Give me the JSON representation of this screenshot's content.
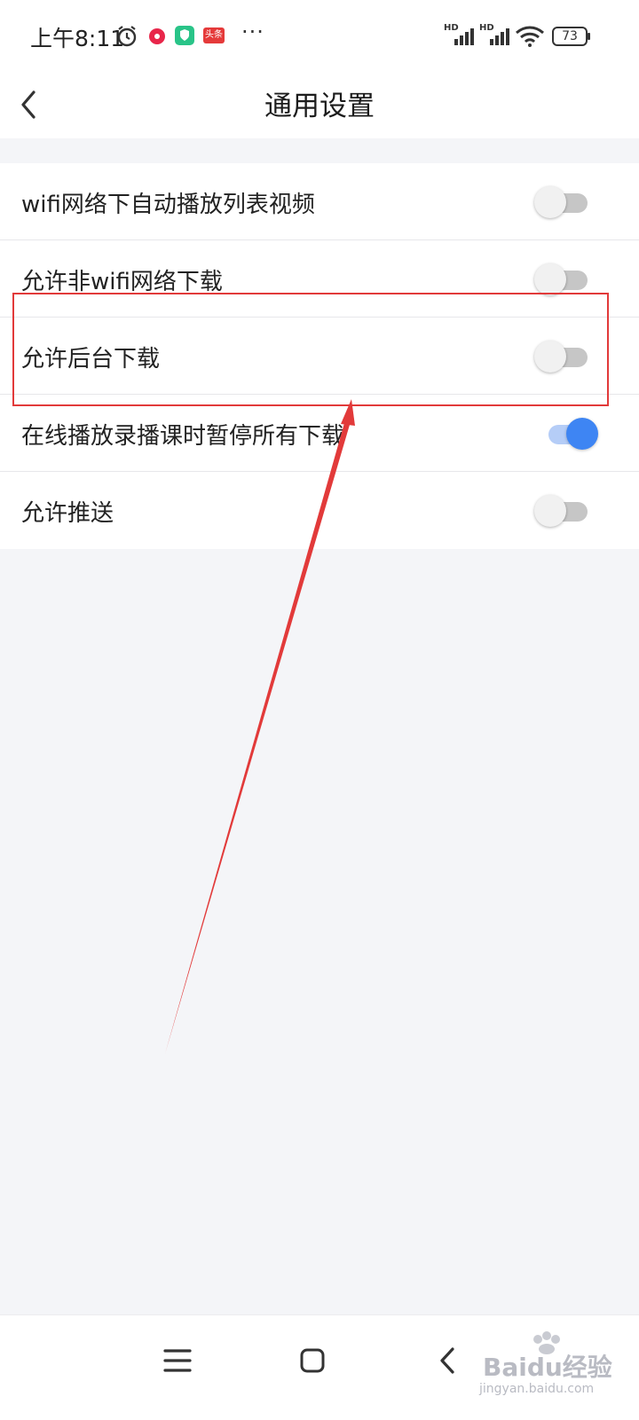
{
  "status_bar": {
    "time": "上午8:11",
    "more": "···",
    "battery": "73",
    "signal_label_1": "HD",
    "signal_label_2": "HD",
    "app_badge": "头条"
  },
  "header": {
    "title": "通用设置"
  },
  "settings": [
    {
      "label": "wifi网络下自动播放列表视频",
      "enabled": false
    },
    {
      "label": "允许非wifi网络下载",
      "enabled": false
    },
    {
      "label": "允许后台下载",
      "enabled": false
    },
    {
      "label": "在线播放录播课时暂停所有下载",
      "enabled": true
    },
    {
      "label": "允许推送",
      "enabled": false
    }
  ],
  "watermark": {
    "main": "Baidu经验",
    "sub": "jingyan.baidu.com"
  },
  "colors": {
    "accent": "#3e85f3",
    "annotation": "#e23a3a",
    "background": "#f4f5f8"
  }
}
